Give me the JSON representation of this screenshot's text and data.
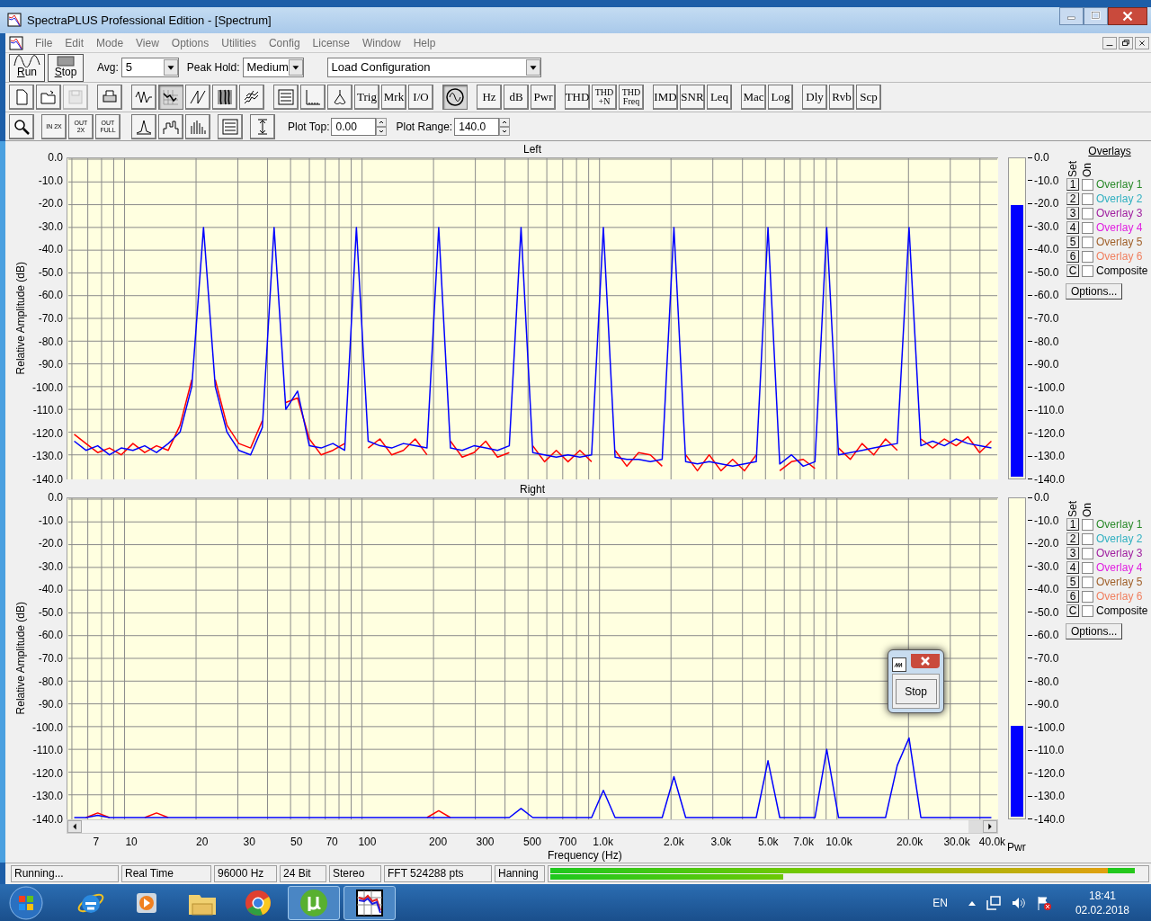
{
  "window": {
    "title": "SpectraPLUS Professional Edition - [Spectrum]"
  },
  "menu": [
    "File",
    "Edit",
    "Mode",
    "View",
    "Options",
    "Utilities",
    "Config",
    "License",
    "Window",
    "Help"
  ],
  "toolbar_1": {
    "run": "Run",
    "stop": "Stop",
    "avg_label": "Avg:",
    "avg_value": "5",
    "peak_hold_label": "Peak Hold:",
    "peak_hold_value": "Medium",
    "config_value": "Load Configuration"
  },
  "toolbar_2": [
    {
      "kind": "icon",
      "pressed": false,
      "disabled": false
    },
    {
      "kind": "icon",
      "pressed": false,
      "disabled": false
    },
    {
      "kind": "icon",
      "pressed": false,
      "disabled": true
    },
    {
      "kind": "icon",
      "pressed": false,
      "disabled": false
    },
    {
      "kind": "icon",
      "pressed": false,
      "disabled": false
    },
    {
      "kind": "icon",
      "pressed": true,
      "disabled": false
    },
    {
      "kind": "icon",
      "pressed": false,
      "disabled": false
    },
    {
      "kind": "icon",
      "pressed": false,
      "disabled": false
    },
    {
      "kind": "icon",
      "pressed": false,
      "disabled": false
    },
    {
      "kind": "icon",
      "pressed": false,
      "disabled": false
    },
    {
      "kind": "icon",
      "pressed": false,
      "disabled": false
    },
    {
      "kind": "icon",
      "pressed": false,
      "disabled": false
    },
    {
      "kind": "text",
      "label": "Trig",
      "pressed": false,
      "disabled": false
    },
    {
      "kind": "text",
      "label": "Mrk",
      "pressed": false,
      "disabled": false
    },
    {
      "kind": "text",
      "label": "I/O",
      "pressed": false,
      "disabled": false
    },
    {
      "kind": "icon",
      "pressed": true,
      "disabled": false
    },
    {
      "kind": "text",
      "label": "Hz",
      "pressed": false,
      "disabled": false
    },
    {
      "kind": "text",
      "label": "dB",
      "pressed": false,
      "disabled": false
    },
    {
      "kind": "text",
      "label": "Pwr",
      "pressed": false,
      "disabled": false
    },
    {
      "kind": "text",
      "label": "THD",
      "pressed": false,
      "disabled": false
    },
    {
      "kind": "text",
      "label": "THD +N",
      "pressed": false,
      "disabled": false
    },
    {
      "kind": "text",
      "label": "THD Freq",
      "pressed": false,
      "disabled": false
    },
    {
      "kind": "text",
      "label": "IMD",
      "pressed": false,
      "disabled": false
    },
    {
      "kind": "text",
      "label": "SNR",
      "pressed": false,
      "disabled": false
    },
    {
      "kind": "text",
      "label": "Leq",
      "pressed": false,
      "disabled": false
    },
    {
      "kind": "text",
      "label": "Mac",
      "pressed": false,
      "disabled": false
    },
    {
      "kind": "text",
      "label": "Log",
      "pressed": false,
      "disabled": false
    },
    {
      "kind": "text",
      "label": "Dly",
      "pressed": false,
      "disabled": false
    },
    {
      "kind": "text",
      "label": "Rvb",
      "pressed": false,
      "disabled": false
    },
    {
      "kind": "text",
      "label": "Scp",
      "pressed": false,
      "disabled": false
    }
  ],
  "toolbar_3": {
    "buttons": [
      {
        "kind": "icon"
      },
      {
        "kind": "zoom_text",
        "label": "IN 2X"
      },
      {
        "kind": "zoom_text",
        "label": "OUT 2X"
      },
      {
        "kind": "zoom_text",
        "label": "OUT FULL"
      },
      {
        "kind": "icon"
      },
      {
        "kind": "icon"
      },
      {
        "kind": "icon"
      },
      {
        "kind": "icon"
      },
      {
        "kind": "icon"
      }
    ],
    "plot_top_label": "Plot Top:",
    "plot_top_value": "0.00",
    "plot_range_label": "Plot Range:",
    "plot_range_value": "140.0"
  },
  "channels": [
    {
      "chart_data": {
        "type": "line",
        "title": "Left",
        "ylabel": "Relative Amplitude (dB)",
        "grid": true,
        "ylim": [
          -140,
          0
        ],
        "yticks": [
          {
            "value": 0,
            "label": "0.0"
          },
          {
            "value": -10,
            "label": "-10.0"
          },
          {
            "value": -20,
            "label": "-20.0"
          },
          {
            "value": -30,
            "label": "-30.0"
          },
          {
            "value": -40,
            "label": "-40.0"
          },
          {
            "value": -50,
            "label": "-50.0"
          },
          {
            "value": -60,
            "label": "-60.0"
          },
          {
            "value": -70,
            "label": "-70.0"
          },
          {
            "value": -80,
            "label": "-80.0"
          },
          {
            "value": -90,
            "label": "-90.0"
          },
          {
            "value": -100,
            "label": "-100.0"
          },
          {
            "value": -110,
            "label": "-110.0"
          },
          {
            "value": -120,
            "label": "-120.0"
          },
          {
            "value": -130,
            "label": "-130.0"
          },
          {
            "value": -140,
            "label": "-140.0"
          }
        ],
        "categories": [
          null,
          null,
          null,
          null,
          null,
          null,
          null,
          null,
          null,
          null,
          null,
          null,
          null,
          null,
          null,
          null,
          null,
          null,
          null,
          null,
          null,
          null,
          null,
          null,
          null,
          null,
          null,
          null,
          null,
          null,
          null,
          null,
          null,
          null,
          null,
          null,
          null,
          null,
          null,
          null,
          null,
          null,
          null,
          null,
          null,
          null,
          null,
          null,
          null,
          null,
          null,
          null,
          null,
          null,
          null,
          null,
          null,
          null,
          null,
          null,
          null,
          null,
          null,
          null,
          null,
          null,
          null,
          null,
          null,
          null,
          null,
          null,
          null,
          null,
          null,
          null,
          null,
          null,
          null
        ],
        "series": [
          {
            "color": "#ff0000",
            "values": [
              -121,
              -125,
              -129,
              -127,
              -130,
              -125,
              -129,
              -126,
              -128,
              -117,
              -97,
              null,
              -97,
              -117,
              -125,
              -127,
              -115,
              null,
              -107,
              -105,
              -123,
              -130,
              -128,
              -125,
              null,
              -127,
              -123,
              -130,
              -128,
              -123,
              -130,
              null,
              -124,
              -131,
              -129,
              -124,
              -131,
              -129,
              null,
              -126,
              -133,
              -128,
              -133,
              -128,
              -133,
              null,
              -128,
              -135,
              -129,
              -130,
              -135,
              null,
              -130,
              -137,
              -130,
              -137,
              -132,
              -137,
              -130,
              null,
              -137,
              -133,
              -132,
              -136,
              null,
              -127,
              -132,
              -125,
              -130,
              -123,
              -128,
              null,
              -123,
              -127,
              -123,
              -126,
              -122,
              -129,
              -124
            ]
          },
          {
            "color": "#0000ff",
            "values": [
              -124,
              -128,
              -126,
              -130,
              -127,
              -128,
              -126,
              -129,
              -125,
              -120,
              -100,
              -30,
              -100,
              -120,
              -128,
              -130,
              -118,
              -30,
              -110,
              -102,
              -126,
              -127,
              -125,
              -128,
              -30,
              -124,
              -126,
              -127,
              -125,
              -126,
              -127,
              -30,
              -127,
              -128,
              -126,
              -127,
              -128,
              -126,
              -30,
              -129,
              -130,
              -131,
              -130,
              -131,
              -130,
              -30,
              -131,
              -132,
              -132,
              -133,
              -132,
              -30,
              -133,
              -134,
              -133,
              -134,
              -135,
              -134,
              -133,
              -30,
              -134,
              -130,
              -135,
              -133,
              -30,
              -130,
              -129,
              -128,
              -127,
              -126,
              -125,
              -30,
              -126,
              -124,
              -126,
              -123,
              -125,
              -126,
              -127
            ]
          }
        ]
      },
      "meter": {
        "level": 0.857,
        "ticks": [
          "0.0",
          "-10.0",
          "-20.0",
          "-30.0",
          "-40.0",
          "-50.0",
          "-60.0",
          "-70.0",
          "-80.0",
          "-90.0",
          "-100.0",
          "-110.0",
          "-120.0",
          "-130.0",
          "-140.0"
        ]
      },
      "overlays": {
        "title": "Overlays",
        "set_header": "Set",
        "on_header": "On",
        "options": "Options...",
        "items": [
          {
            "set": "1",
            "label": "Overlay 1",
            "checked": false,
            "color": "#2a8a2a"
          },
          {
            "set": "2",
            "label": "Overlay 2",
            "checked": false,
            "color": "#30b0c0"
          },
          {
            "set": "3",
            "label": "Overlay 3",
            "checked": false,
            "color": "#a020a0"
          },
          {
            "set": "4",
            "label": "Overlay 4",
            "checked": false,
            "color": "#e020e0"
          },
          {
            "set": "5",
            "label": "Overlay 5",
            "checked": false,
            "color": "#a0602a"
          },
          {
            "set": "6",
            "label": "Overlay 6",
            "checked": false,
            "color": "#f08060"
          },
          {
            "set": "C",
            "label": "Composite",
            "checked": false,
            "color": "#000000"
          }
        ]
      }
    },
    {
      "chart_data": {
        "type": "line",
        "title": "Right",
        "xlabel": "Frequency (Hz)",
        "ylabel": "Relative Amplitude (dB)",
        "grid": true,
        "ylim": [
          -140,
          0
        ],
        "yticks": [
          {
            "value": 0,
            "label": "0.0"
          },
          {
            "value": -10,
            "label": "-10.0"
          },
          {
            "value": -20,
            "label": "-20.0"
          },
          {
            "value": -30,
            "label": "-30.0"
          },
          {
            "value": -40,
            "label": "-40.0"
          },
          {
            "value": -50,
            "label": "-50.0"
          },
          {
            "value": -60,
            "label": "-60.0"
          },
          {
            "value": -70,
            "label": "-70.0"
          },
          {
            "value": -80,
            "label": "-80.0"
          },
          {
            "value": -90,
            "label": "-90.0"
          },
          {
            "value": -100,
            "label": "-100.0"
          },
          {
            "value": -110,
            "label": "-110.0"
          },
          {
            "value": -120,
            "label": "-120.0"
          },
          {
            "value": -130,
            "label": "-130.0"
          },
          {
            "value": -140,
            "label": "-140.0"
          }
        ],
        "categories": [
          null,
          null,
          "7",
          null,
          null,
          "10",
          null,
          null,
          null,
          null,
          null,
          "20",
          null,
          null,
          null,
          "30",
          null,
          null,
          null,
          "50",
          null,
          null,
          "70",
          null,
          null,
          "100",
          null,
          null,
          null,
          null,
          null,
          "200",
          null,
          null,
          null,
          "300",
          null,
          null,
          null,
          "500",
          null,
          null,
          "700",
          null,
          null,
          "1.0k",
          null,
          null,
          null,
          null,
          null,
          "2.0k",
          null,
          null,
          null,
          "3.0k",
          null,
          null,
          null,
          "5.0k",
          null,
          null,
          "7.0k",
          null,
          null,
          "10.0k",
          null,
          null,
          null,
          null,
          null,
          "20.0k",
          null,
          null,
          null,
          "30.0k",
          null,
          null,
          "40.0k"
        ],
        "series": [
          {
            "color": "#ff0000",
            "values": [
              null,
              -140,
              -138,
              -140,
              null,
              null,
              -140,
              -138,
              -140,
              null,
              null,
              null,
              null,
              null,
              null,
              null,
              null,
              null,
              null,
              null,
              null,
              null,
              null,
              null,
              null,
              null,
              null,
              null,
              null,
              null,
              -140,
              -137,
              -140,
              null,
              null,
              null,
              null,
              null,
              null,
              null,
              null,
              null,
              null,
              null,
              null,
              null,
              null,
              null,
              null,
              null,
              null,
              null,
              null,
              null,
              null,
              null,
              null,
              null,
              null,
              null,
              null,
              null,
              null,
              null,
              null,
              null,
              null,
              null,
              null,
              null,
              null,
              null,
              null,
              null,
              null,
              null,
              null,
              null,
              null
            ]
          },
          {
            "color": "#0000ff",
            "values": [
              -140,
              -140,
              -139,
              -140,
              -140,
              -140,
              -140,
              -140,
              -140,
              -140,
              -140,
              -140,
              -140,
              -140,
              -140,
              -140,
              -140,
              -140,
              -140,
              -140,
              -140,
              -140,
              -140,
              -140,
              -140,
              -140,
              -140,
              -140,
              -140,
              -140,
              -140,
              -140,
              -140,
              -140,
              -140,
              -140,
              -140,
              -140,
              -136,
              -140,
              -140,
              -140,
              -140,
              -140,
              -140,
              -128,
              -140,
              -140,
              -140,
              -140,
              -140,
              -122,
              -140,
              -140,
              -140,
              -140,
              -140,
              -140,
              -140,
              -115,
              -140,
              -140,
              -140,
              -140,
              -110,
              -140,
              -140,
              -140,
              -140,
              -140,
              -117,
              -105,
              -140,
              -140,
              -140,
              -140,
              -140,
              -140,
              -140
            ]
          }
        ]
      },
      "meter": {
        "level": 0.286,
        "label": "Pwr",
        "ticks": [
          "0.0",
          "-10.0",
          "-20.0",
          "-30.0",
          "-40.0",
          "-50.0",
          "-60.0",
          "-70.0",
          "-80.0",
          "-90.0",
          "-100.0",
          "-110.0",
          "-120.0",
          "-130.0",
          "-140.0"
        ]
      },
      "overlays": {
        "set_header": "Set",
        "on_header": "On",
        "options": "Options...",
        "items": [
          {
            "set": "1",
            "label": "Overlay 1",
            "checked": false,
            "color": "#2a8a2a"
          },
          {
            "set": "2",
            "label": "Overlay 2",
            "checked": false,
            "color": "#30b0c0"
          },
          {
            "set": "3",
            "label": "Overlay 3",
            "checked": false,
            "color": "#a020a0"
          },
          {
            "set": "4",
            "label": "Overlay 4",
            "checked": false,
            "color": "#e020e0"
          },
          {
            "set": "5",
            "label": "Overlay 5",
            "checked": false,
            "color": "#a0602a"
          },
          {
            "set": "6",
            "label": "Overlay 6",
            "checked": false,
            "color": "#f08060"
          },
          {
            "set": "C",
            "label": "Composite",
            "checked": false,
            "color": "#000000"
          }
        ]
      }
    }
  ],
  "dialog": {
    "button": "Stop"
  },
  "status_bar": {
    "fields": [
      "Running...",
      "Real Time",
      "96000 Hz",
      "24 Bit",
      "Stereo",
      "FFT 524288 pts",
      "Hanning"
    ],
    "meters": [
      {
        "level": 0.98
      },
      {
        "level": 0.39
      }
    ]
  },
  "taskbar": {
    "apps": [
      {
        "kind": "ie",
        "running": false
      },
      {
        "kind": "media",
        "running": false
      },
      {
        "kind": "folder",
        "running": false
      },
      {
        "kind": "chrome",
        "running": false
      },
      {
        "kind": "torrent",
        "running": true
      },
      {
        "kind": "spectrum",
        "running": true
      }
    ],
    "language": "EN",
    "time": "18:41",
    "date": "02.02.2018"
  }
}
